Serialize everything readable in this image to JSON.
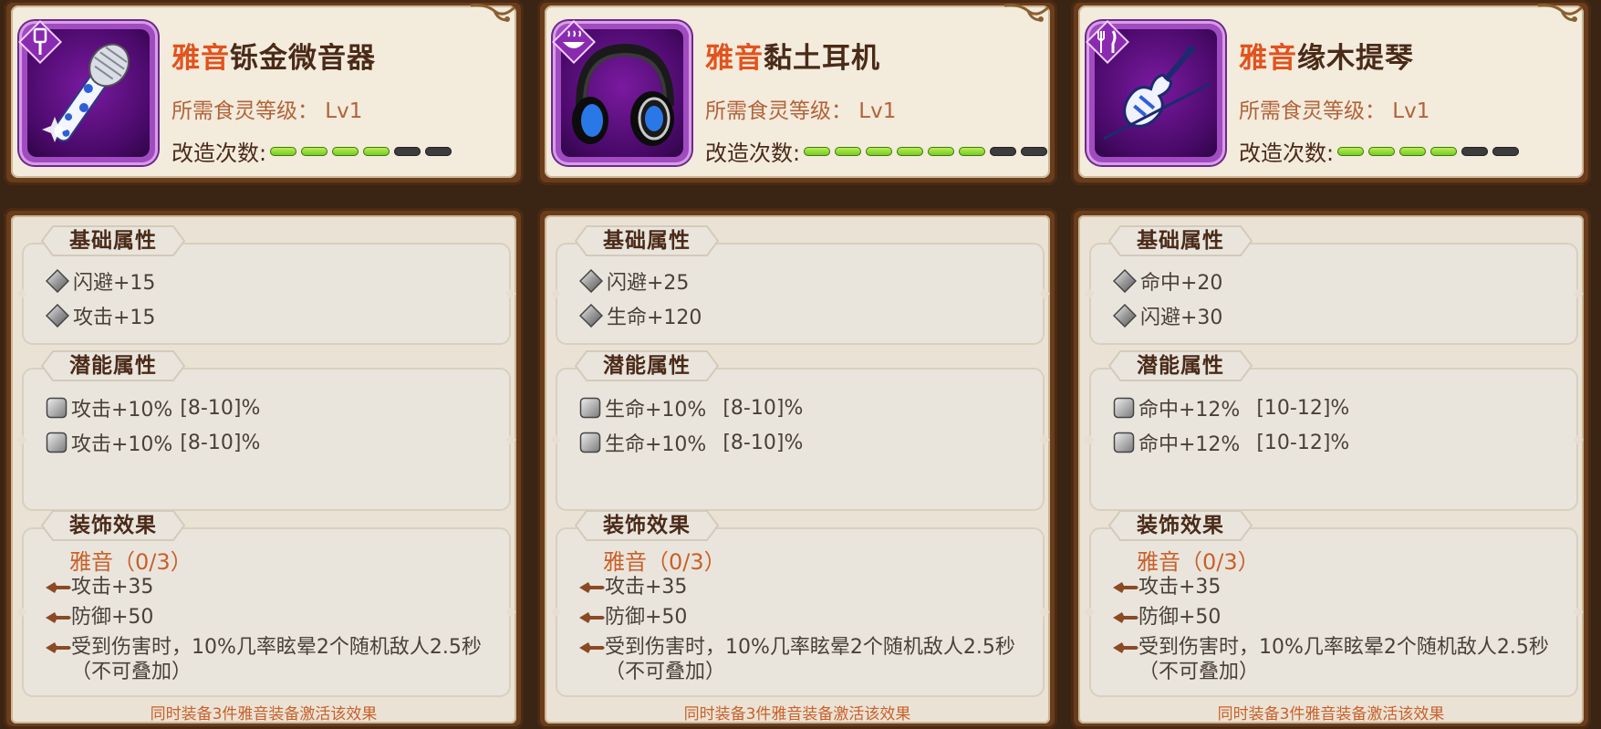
{
  "colors": {
    "set_name": "#e2531e",
    "item_name": "#4a2a18",
    "requirement": "#b2633a",
    "set_hint": "#c9602a",
    "pip_on": "#8ad82a",
    "pip_off": "#3c3c3c",
    "rarity_frame": "#a04cc0"
  },
  "items": [
    {
      "category_icon": "spatula-icon",
      "item_icon": "microphone-icon",
      "name_set": "雅音",
      "name_rest": "铄金微音器",
      "requirement": "所需食灵等级：  Lv1",
      "refine_label": "改造次数:",
      "refine_filled": 4,
      "refine_total": 6,
      "basic_title": "基础属性",
      "basic_stats": [
        "闪避+15",
        "攻击+15"
      ],
      "potential_title": "潜能属性",
      "potential_stats": [
        {
          "stat": "攻击+10%",
          "range": "[8-10]%"
        },
        {
          "stat": "攻击+10%",
          "range": "[8-10]%"
        }
      ],
      "deco_title": "装饰效果",
      "set_progress": "雅音（0/3）",
      "effects": [
        "攻击+35",
        "防御+50",
        "受到伤害时，10%几率眩晕2个随机敌人2.5秒（不可叠加）"
      ],
      "set_hint": "同时装备3件雅音装备激活该效果"
    },
    {
      "category_icon": "bowl-icon",
      "item_icon": "headphones-icon",
      "name_set": "雅音",
      "name_rest": "黏土耳机",
      "requirement": "所需食灵等级：  Lv1",
      "refine_label": "改造次数:",
      "refine_filled": 6,
      "refine_total": 8,
      "basic_title": "基础属性",
      "basic_stats": [
        "闪避+25",
        "生命+120"
      ],
      "potential_title": "潜能属性",
      "potential_stats": [
        {
          "stat": "生命+10%",
          "range": "[8-10]%"
        },
        {
          "stat": "生命+10%",
          "range": "[8-10]%"
        }
      ],
      "deco_title": "装饰效果",
      "set_progress": "雅音（0/3）",
      "effects": [
        "攻击+35",
        "防御+50",
        "受到伤害时，10%几率眩晕2个随机敌人2.5秒（不可叠加）"
      ],
      "set_hint": "同时装备3件雅音装备激活该效果"
    },
    {
      "category_icon": "fork-knife-icon",
      "item_icon": "violin-icon",
      "name_set": "雅音",
      "name_rest": "缘木提琴",
      "requirement": "所需食灵等级：  Lv1",
      "refine_label": "改造次数:",
      "refine_filled": 4,
      "refine_total": 6,
      "basic_title": "基础属性",
      "basic_stats": [
        "命中+20",
        "闪避+30"
      ],
      "potential_title": "潜能属性",
      "potential_stats": [
        {
          "stat": "命中+12%",
          "range": "[10-12]%"
        },
        {
          "stat": "命中+12%",
          "range": "[10-12]%"
        }
      ],
      "deco_title": "装饰效果",
      "set_progress": "雅音（0/3）",
      "effects": [
        "攻击+35",
        "防御+50",
        "受到伤害时，10%几率眩晕2个随机敌人2.5秒（不可叠加）"
      ],
      "set_hint": "同时装备3件雅音装备激活该效果"
    }
  ]
}
